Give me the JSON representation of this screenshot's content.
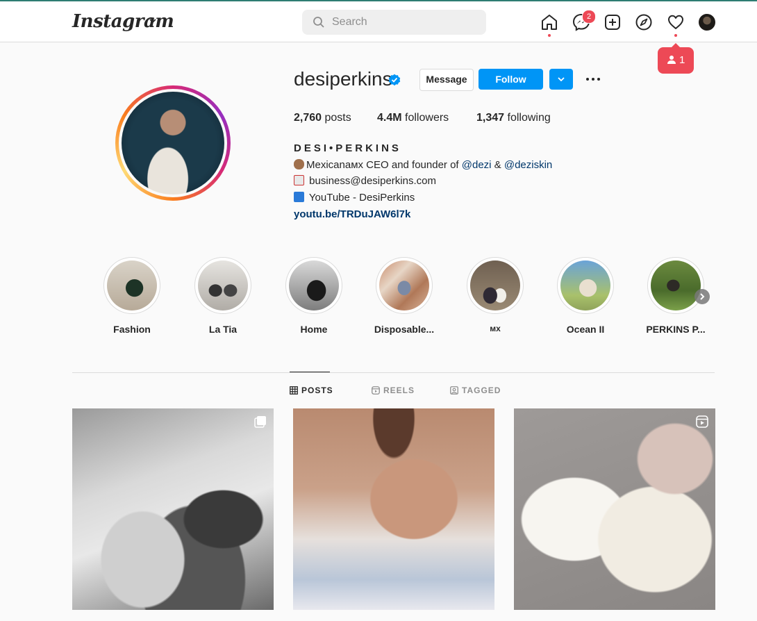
{
  "header": {
    "logo_text": "Instagram",
    "search_placeholder": "Search",
    "messages_badge": "2",
    "notification_popup_count": "1"
  },
  "profile": {
    "username": "desiperkins",
    "message_label": "Message",
    "follow_label": "Follow",
    "stats": {
      "posts_count": "2,760",
      "posts_label": "posts",
      "followers_count": "4.4M",
      "followers_label": "followers",
      "following_count": "1,347",
      "following_label": "following"
    },
    "full_name": "DESI•PERKINS",
    "bio": {
      "line1_text": "Mexicanaмx CEO and founder of ",
      "line1_mention1": "@dezi",
      "line1_and": " & ",
      "line1_mention2": "@deziskin",
      "line2": "business@desiperkins.com",
      "line3": "YouTube - DesiPerkins"
    },
    "link": "youtu.be/TRDuJAW6l7k"
  },
  "highlights": [
    {
      "label": "Fashion"
    },
    {
      "label": "La Tia"
    },
    {
      "label": "Home"
    },
    {
      "label": "Disposable..."
    },
    {
      "label": "мx"
    },
    {
      "label": "Ocean II"
    },
    {
      "label": "PERKINS P..."
    }
  ],
  "tabs": {
    "posts": "POSTS",
    "reels": "REELS",
    "tagged": "TAGGED"
  },
  "colors": {
    "accent_blue": "#0095f6",
    "notification_red": "#ed4956",
    "link_blue": "#00376b"
  },
  "icons": {
    "home": "home-icon",
    "messenger": "messenger-icon",
    "new_post": "plus-square-icon",
    "explore": "compass-icon",
    "activity": "heart-icon",
    "verified": "verified-badge-icon"
  }
}
